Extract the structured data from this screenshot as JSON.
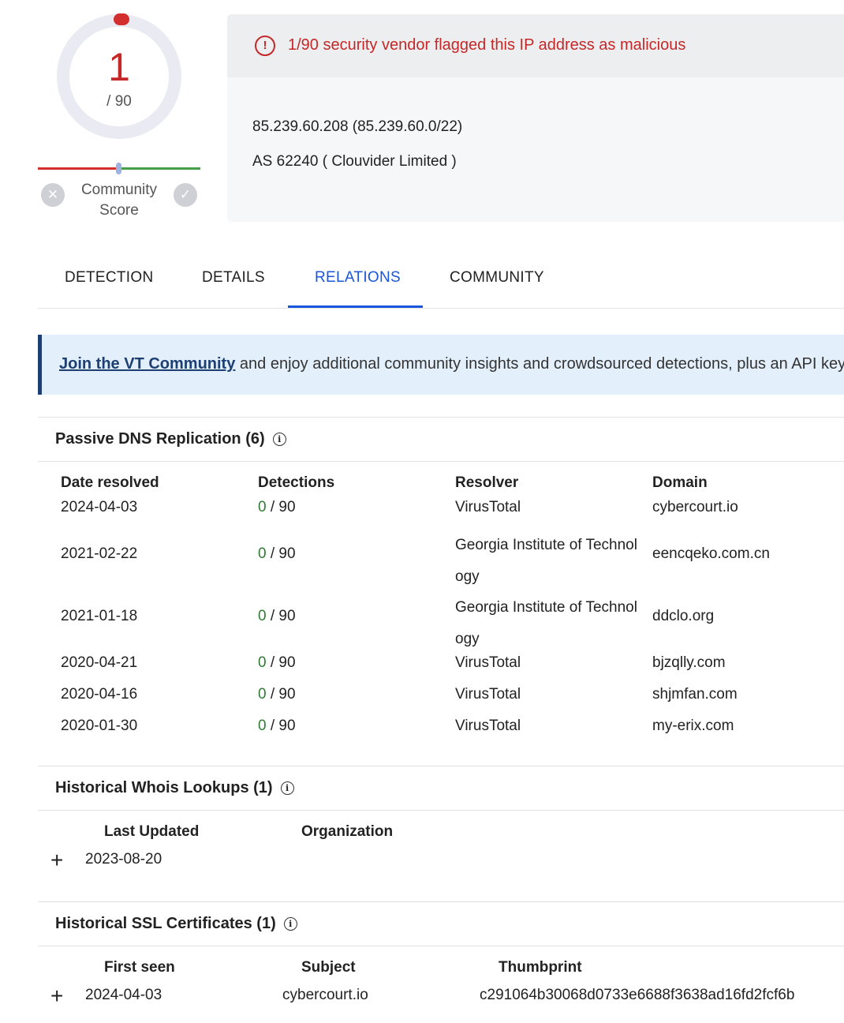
{
  "score": {
    "malicious": "1",
    "total": "/ 90",
    "community_label": "Community\nScore",
    "downvote_icon": "close-icon",
    "upvote_icon": "check-icon"
  },
  "header": {
    "alert_text": "1/90 security vendor flagged this IP address as malicious",
    "ip_line": "85.239.60.208  (85.239.60.0/22)",
    "as_line": "AS 62240  ( Clouvider Limited )"
  },
  "tabs": [
    {
      "label": "DETECTION"
    },
    {
      "label": "DETAILS"
    },
    {
      "label": "RELATIONS"
    },
    {
      "label": "COMMUNITY"
    }
  ],
  "banner": {
    "link": "Join the VT Community",
    "text": " and enjoy additional community insights and crowdsourced detections, plus an API key"
  },
  "passive_dns": {
    "title": "Passive DNS Replication",
    "count": "(6)",
    "headers": [
      "Date resolved",
      "Detections",
      "Resolver",
      "Domain"
    ],
    "rows": [
      {
        "date": "2024-04-03",
        "det": "0",
        "total": " / 90",
        "resolver": "VirusTotal",
        "domain": "cybercourt.io"
      },
      {
        "date": "2021-02-22",
        "det": "0",
        "total": " / 90",
        "resolver": "Georgia Institute of Technology",
        "domain": "eencqeko.com.cn"
      },
      {
        "date": "2021-01-18",
        "det": "0",
        "total": " / 90",
        "resolver": "Georgia Institute of Technology",
        "domain": "ddclo.org"
      },
      {
        "date": "2020-04-21",
        "det": "0",
        "total": " / 90",
        "resolver": "VirusTotal",
        "domain": "bjzqlly.com"
      },
      {
        "date": "2020-04-16",
        "det": "0",
        "total": " / 90",
        "resolver": "VirusTotal",
        "domain": "shjmfan.com"
      },
      {
        "date": "2020-01-30",
        "det": "0",
        "total": " / 90",
        "resolver": "VirusTotal",
        "domain": "my-erix.com"
      }
    ]
  },
  "whois": {
    "title": "Historical Whois Lookups",
    "count": "(1)",
    "headers": [
      "Last Updated",
      "Organization"
    ],
    "rows": [
      {
        "updated": "2023-08-20",
        "org": ""
      }
    ]
  },
  "ssl": {
    "title": "Historical SSL Certificates",
    "count": "(1)",
    "headers": [
      "First seen",
      "Subject",
      "Thumbprint"
    ],
    "rows": [
      {
        "first_seen": "2024-04-03",
        "subject": "cybercourt.io",
        "thumbprint": "c291064b30068d0733e6688f3638ad16fd2fcf6b"
      }
    ]
  },
  "colors": {
    "malicious": "#c62828",
    "accent": "#1a56db",
    "clean": "#2e7d32",
    "banner_bg": "#e3f0fb"
  }
}
